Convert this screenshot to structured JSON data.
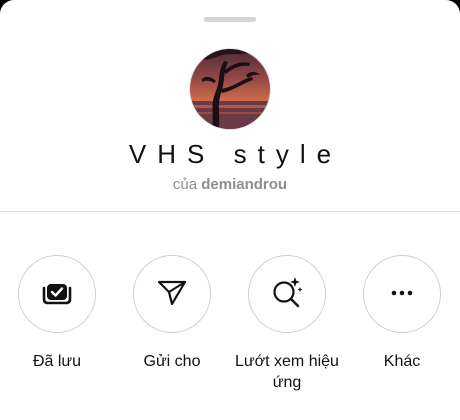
{
  "effect": {
    "name": "VHS style",
    "by_prefix": "của",
    "author": "demiandrou"
  },
  "actions": [
    {
      "label": "Đã lưu",
      "icon": "saved-check-icon"
    },
    {
      "label": "Gửi cho",
      "icon": "send-paper-plane-icon"
    },
    {
      "label": "Lướt xem hiệu ứng",
      "icon": "browse-effects-sparkle-icon"
    },
    {
      "label": "Khác",
      "icon": "more-dots-icon"
    }
  ]
}
